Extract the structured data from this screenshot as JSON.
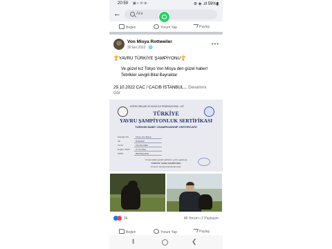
{
  "status_bar": {
    "time": "20:59",
    "left_icons": "▣ ◐ ✉ ⊕ ·",
    "right": "⊛ ◈ .ıll 59%▮"
  },
  "search": {
    "back_icon": "←",
    "placeholder": "Ara"
  },
  "top_actions": {
    "like": "Beğen",
    "comment": "Yorum Yap",
    "share": "Paylaş"
  },
  "post": {
    "author": "Von Misya Rottweiler",
    "date": "30 Eki 2022 · 🌐",
    "title": "🏆YAVRU TÜRKİYE ŞAMPİYONU🏆",
    "line1": "Ve güzel kız Tokyo Von Misya den güzel haber!",
    "line2": "Tebrikler sevgili Bilal Bayraktar",
    "line3": "29.10.2022 CAC / CACIB İSTANBUL...",
    "see_more": "Devamını",
    "see_more_2": "Gör"
  },
  "certificate": {
    "org": "KÖPEK IRKLARI VE KINOLOJİ FEDERASYONU - KIF",
    "title1": "TÜRKİYE",
    "title2": "YAVRU ŞAMPİYONLUK SERTİFİKASI",
    "title3": "TURKISH BABY CHAMPIONSHIP CERTIFICATE",
    "fields": [
      {
        "label": "Köpeğin Adı",
        "value": "Tokyo Von Misya"
      },
      {
        "label": "Irkı",
        "value": "Rottweiler"
      },
      {
        "label": "Irk No",
        "value": "KIF-RO-0000"
      },
      {
        "label": "Doğum Tarihi",
        "value": "27.04.2022"
      },
      {
        "label": "Sahibi",
        "value": "Bilal Bayraktar"
      }
    ],
    "footer1": "Yönetmeliğin gerekli şartlarını yerine getirerek",
    "footer2": "TÜRKİYE YAVRU ŞAMPİYONU",
    "footer3": "ünvanını almaya hak kazanmıştır."
  },
  "reactions": {
    "count": "36",
    "comments_shares": "48 Yorum • 2 Paylaşım"
  },
  "bottom_actions": {
    "like": "Beğen",
    "comment": "Yorum Yap",
    "share": "Paylaş"
  },
  "nav": {
    "recent": "|||",
    "back": "❮"
  },
  "colors": {
    "facebook_blue": "#1877f2",
    "heart_red": "#f33e58",
    "whatsapp_green": "#25d366",
    "cert_blue": "#1d2f6b"
  },
  "icons": [
    "back-arrow-icon",
    "search-icon",
    "whatsapp-icon",
    "like-icon",
    "comment-icon",
    "share-icon",
    "more-options-icon",
    "globe-icon",
    "trophy-icon",
    "like-reaction-icon",
    "love-reaction-icon",
    "recent-apps-icon",
    "home-icon",
    "nav-back-icon"
  ]
}
